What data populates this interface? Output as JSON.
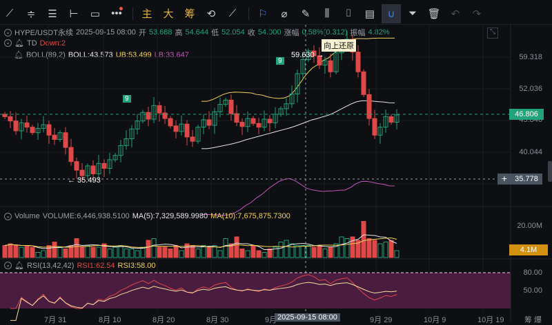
{
  "toolbar": {
    "items": [
      {
        "icon": "trend-line-icon",
        "glyph": "⟋"
      },
      {
        "icon": "parallel-lines-icon",
        "glyph": "≑"
      },
      {
        "icon": "fib-lines-icon",
        "glyph": "☰"
      },
      {
        "icon": "horizontal-line-icon",
        "glyph": "⊢"
      },
      {
        "icon": "rectangle-icon",
        "glyph": "▭"
      },
      {
        "icon": "more-icon",
        "glyph": "•••"
      }
    ],
    "cn_items": [
      "主",
      "大",
      "筹"
    ],
    "tools": [
      {
        "icon": "replay-icon",
        "glyph": "⟲"
      },
      {
        "icon": "measure-icon",
        "glyph": "⟋"
      },
      {
        "icon": "bookmark-icon",
        "glyph": "⚐"
      },
      {
        "icon": "ruler-icon",
        "glyph": "⌀"
      },
      {
        "icon": "pencil-icon",
        "glyph": "✎"
      },
      {
        "icon": "candles-icon",
        "glyph": "⫼"
      },
      {
        "icon": "single-candle-icon",
        "glyph": "⌷"
      },
      {
        "icon": "note-icon",
        "glyph": "▤"
      },
      {
        "icon": "magnet-icon",
        "glyph": "∪"
      },
      {
        "icon": "filter-icon",
        "glyph": "⏷"
      },
      {
        "icon": "trash-icon",
        "glyph": "🗑"
      },
      {
        "icon": "undo-icon",
        "glyph": "↶"
      },
      {
        "icon": "redo-icon",
        "glyph": "↷"
      }
    ]
  },
  "header": {
    "symbol": "HYPE/USDT永续",
    "time": "2025-09-15 08:00",
    "open_label": "开",
    "open": "53.688",
    "high_label": "高",
    "high": "54.644",
    "low_label": "低",
    "low": "52.054",
    "close_label": "收",
    "close": "54.000",
    "change_label": "涨幅",
    "change": "0.58%(0.312)",
    "amp_label": "振幅",
    "amp": "4.82%"
  },
  "td": {
    "label": "TD",
    "value": "Down:2"
  },
  "boll": {
    "label": "BOLL(89,2)",
    "boll": "BOLL:43.573",
    "ub": "UB:53.499",
    "lb": "LB:33.647"
  },
  "annotations": {
    "high": "59.630 →",
    "low": "← 35.493",
    "tooltip": "向上还原",
    "td9": "9"
  },
  "price_axis": {
    "ticks": [
      "59.318",
      "52.036",
      "45.846",
      "40.044"
    ],
    "last_price": "46.806",
    "cross_price": "35.778"
  },
  "volume": {
    "label": "Volume",
    "value": "VOLUME:6,446,938.5100",
    "ma5": "MA(5):7,329,589.9980",
    "ma10": "MA(10):7,675,875.7300",
    "tick": "20.00M",
    "last": "4.1M"
  },
  "rsi": {
    "label": "RSI(13,42,42)",
    "rsi1": "RSI1:62.54",
    "rsi3": "RSI3:58.00",
    "ticks": [
      "80.00",
      "50.00"
    ]
  },
  "x_axis": {
    "labels": [
      "7月 31",
      "8月 10",
      "8月 20",
      "8月 30",
      "9月",
      "9月 29",
      "10月 9",
      "10月 19"
    ],
    "crosshair": "2025-09-15 08:00",
    "right": "筹 爆"
  },
  "colors": {
    "up": "#22a37a",
    "down": "#e04848",
    "boll_mid": "#e6e6e6",
    "ub": "#f2d35a",
    "lb": "#c058b8",
    "rsi_bg": "#4a1c3f"
  },
  "chart_data": {
    "type": "candlestick",
    "closes": [
      46.5,
      45.8,
      44.2,
      45.5,
      44.8,
      43.9,
      44.6,
      45.2,
      43.5,
      42.8,
      43.9,
      41.5,
      39.2,
      37.8,
      36.9,
      38.5,
      37.2,
      38.9,
      38.1,
      39.5,
      40.2,
      41.8,
      42.9,
      44.5,
      45.8,
      47.2,
      46.1,
      48.3,
      47.1,
      46.2,
      45.0,
      44.1,
      45.3,
      43.2,
      42.5,
      44.8,
      46.0,
      45.1,
      47.3,
      48.5,
      49.2,
      47.0,
      45.6,
      44.9,
      46.2,
      45.4,
      44.8,
      46.1,
      45.5,
      46.9,
      47.8,
      48.6,
      50.2,
      53.5,
      55.8,
      57.2,
      56.4,
      54.9,
      55.6,
      53.8,
      56.9,
      58.2,
      59.1,
      57.0,
      53.8,
      50.1,
      46.2,
      43.5,
      44.8,
      46.5,
      45.6,
      46.8
    ],
    "volumes_m": [
      7,
      8,
      7,
      6,
      7,
      6,
      3,
      4,
      7,
      9,
      6,
      5,
      7,
      11,
      6,
      7,
      6,
      6,
      8,
      5,
      6,
      7,
      5,
      5,
      4,
      6,
      10,
      11,
      6,
      6,
      5,
      7,
      4,
      8,
      7,
      5,
      7,
      6,
      7,
      4,
      11,
      8,
      12,
      5,
      4,
      7,
      4,
      3,
      5,
      6,
      9,
      10,
      8,
      7,
      7,
      7,
      6,
      7,
      5,
      6,
      8,
      12,
      11,
      12,
      10,
      21,
      11,
      10,
      8,
      9,
      10,
      4
    ],
    "ylim": [
      33,
      61
    ]
  }
}
